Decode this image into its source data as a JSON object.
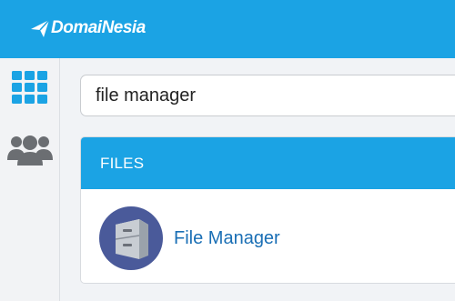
{
  "header": {
    "logo_text": "DomaiNesia",
    "brand_color": "#1ba3e4"
  },
  "sidebar": {
    "items": [
      {
        "icon": "apps-grid-icon",
        "color": "#1ba3e4"
      },
      {
        "icon": "users-icon",
        "color": "#6b6e72"
      }
    ]
  },
  "search": {
    "value": "file manager"
  },
  "panel": {
    "title": "FILES",
    "items": [
      {
        "label": "File Manager",
        "icon": "file-cabinet-icon",
        "icon_bg": "#4a5a9a"
      }
    ]
  }
}
